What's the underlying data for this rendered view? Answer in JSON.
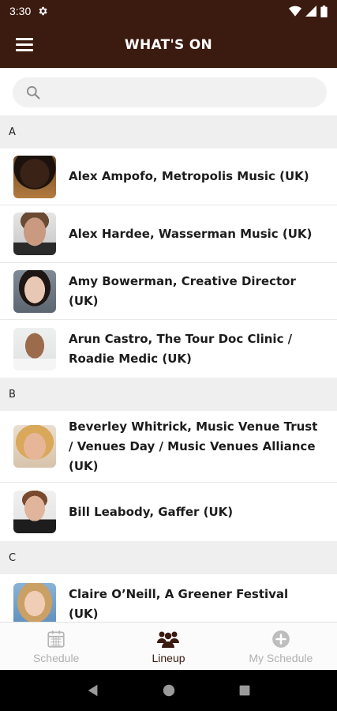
{
  "status_bar": {
    "time": "3:30"
  },
  "app_bar": {
    "title": "WHAT'S ON"
  },
  "search": {
    "placeholder": ""
  },
  "sections": [
    {
      "letter": "A",
      "people": [
        {
          "name": "Alex Ampofo, Metropolis Music (UK)"
        },
        {
          "name": "Alex Hardee, Wasserman Music (UK)"
        },
        {
          "name": "Amy Bowerman, Creative Director (UK)"
        },
        {
          "name": "Arun Castro, The Tour Doc  Clinic / Roadie Medic (UK)"
        }
      ]
    },
    {
      "letter": "B",
      "people": [
        {
          "name": "Beverley Whitrick,  Music Venue Trust / Venues Day / Music Venues Alliance (UK)"
        },
        {
          "name": "Bill Leabody, Gaffer (UK)"
        }
      ]
    },
    {
      "letter": "C",
      "people": [
        {
          "name": "Claire O’Neill, A Greener Festival (UK)"
        }
      ]
    }
  ],
  "bottom_nav": {
    "tabs": [
      {
        "label": "Schedule",
        "icon": "calendar-icon"
      },
      {
        "label": "Lineup",
        "icon": "people-icon"
      },
      {
        "label": "My Schedule",
        "icon": "plus-circle-icon"
      }
    ],
    "active_tab": "Lineup"
  },
  "colors": {
    "brand": "#3b1a0f",
    "inactive": "#b0b0b0"
  }
}
